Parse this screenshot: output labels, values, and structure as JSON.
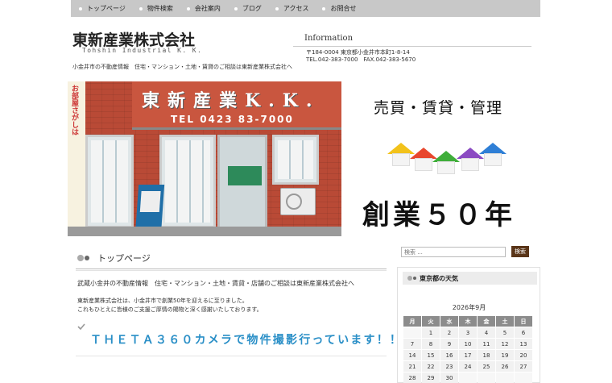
{
  "nav": {
    "items": [
      {
        "label": "トップページ"
      },
      {
        "label": "物件検索"
      },
      {
        "label": "会社案内"
      },
      {
        "label": "ブログ"
      },
      {
        "label": "アクセス"
      },
      {
        "label": "お問合せ"
      }
    ]
  },
  "header": {
    "company_name": "東新産業株式会社",
    "company_name_en": "Tohshin Industrial K. K.",
    "tagline": "小金井市の不動産情報　住宅・マンション・土地・賃貸のご相談は東新産業株式会社へ",
    "info_title": "Information",
    "address": "〒184-0004 東京都小金井市本町1-8-14",
    "contact": "TEL.042-383-7000　FAX.042-383-5670"
  },
  "banner": {
    "sign_text": "東新産業K.K.",
    "sign_tel": "TEL 0423 83-7000",
    "side_banner_text": "お部屋さがしは",
    "slogan": "売買・賃貸・管理",
    "anniversary": "創業５０年",
    "house_colors": [
      "#f2c21b",
      "#e8472e",
      "#3fae3a",
      "#8b4bc2",
      "#2f7fd6"
    ]
  },
  "main": {
    "heading": "トップページ",
    "lead": "武蔵小金井の不動産情報　住宅・マンション・土地・賃貸・店舗のご相談は東新産業株式会社へ",
    "body_line1": "東新産業株式会社は、小金井市で創業50年を迎えるに至りました。",
    "body_line2": "これもひとえに皆様のご支援ご厚情の賜物と深く感謝いたしております。",
    "theta_headline": "ＴＨＥＴＡ３６０カメラで物件撮影行っています！！",
    "accent_color": "#2a8fc7"
  },
  "sidebar": {
    "search_placeholder": "検索 ...",
    "search_button": "検索",
    "weather_title": "東京都の天気",
    "calendar": {
      "title": "2026年9月",
      "weekdays": [
        "月",
        "火",
        "水",
        "木",
        "金",
        "土",
        "日"
      ],
      "weeks": [
        [
          "",
          "1",
          "2",
          "3",
          "4",
          "5",
          "6"
        ],
        [
          "7",
          "8",
          "9",
          "10",
          "11",
          "12",
          "13"
        ],
        [
          "14",
          "15",
          "16",
          "17",
          "18",
          "19",
          "20"
        ],
        [
          "21",
          "22",
          "23",
          "24",
          "25",
          "26",
          "27"
        ],
        [
          "28",
          "29",
          "30",
          "",
          "",
          "",
          ""
        ]
      ]
    }
  }
}
